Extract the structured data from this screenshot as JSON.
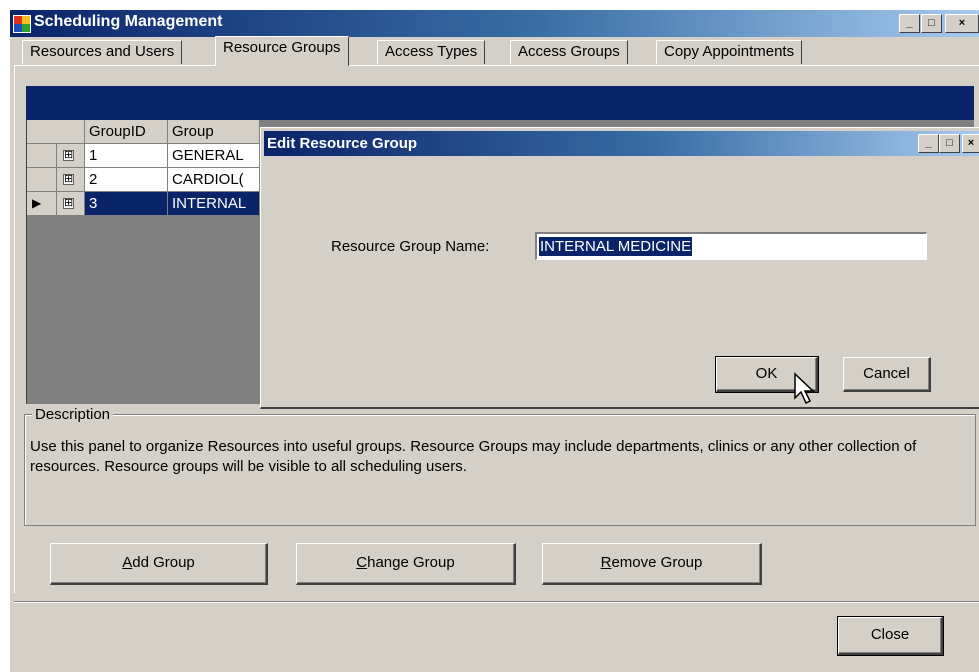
{
  "window": {
    "title": "Scheduling Management",
    "minimize_glyph": "_",
    "maximize_glyph": "□",
    "close_glyph": "×"
  },
  "tabs": [
    {
      "label": "Resources and Users",
      "active": false
    },
    {
      "label": "Resource Groups",
      "active": true
    },
    {
      "label": "Access Types",
      "active": false
    },
    {
      "label": "Access Groups",
      "active": false
    },
    {
      "label": "Copy Appointments",
      "active": false
    }
  ],
  "grid": {
    "columns": [
      "GroupID",
      "Group"
    ],
    "rows": [
      {
        "id": "1",
        "group": "GENERAL",
        "selected": false,
        "expander": "⊞"
      },
      {
        "id": "2",
        "group": "CARDIOL(",
        "selected": false,
        "expander": "⊞"
      },
      {
        "id": "3",
        "group": "INTERNAL",
        "selected": true,
        "expander": "⊞",
        "pointer": "▶"
      }
    ]
  },
  "description": {
    "legend": "Description",
    "text": "Use this panel to organize Resources into useful groups.  Resource Groups may include departments, clinics or any other collection of resources.  Resource groups will be visible to all scheduling users."
  },
  "buttons": {
    "add_group": {
      "mnemonic": "A",
      "rest": "dd Group"
    },
    "change_group": {
      "mnemonic": "C",
      "rest": "hange Group"
    },
    "remove_group": {
      "mnemonic": "R",
      "rest": "emove Group"
    },
    "close": "Close"
  },
  "dialog": {
    "title": "Edit Resource Group",
    "field_label": "Resource Group Name:",
    "field_value": "INTERNAL MEDICINE",
    "ok_label": "OK",
    "cancel_label": "Cancel"
  },
  "colors": {
    "face": "#d4d0c8",
    "selection": "#0a246a",
    "titlebar_start": "#0a246a",
    "titlebar_end": "#a6caf0"
  },
  "icons": [
    "app-icon",
    "minimize-icon",
    "maximize-icon",
    "close-icon",
    "expand-icon",
    "row-pointer-icon",
    "mouse-cursor-icon"
  ]
}
